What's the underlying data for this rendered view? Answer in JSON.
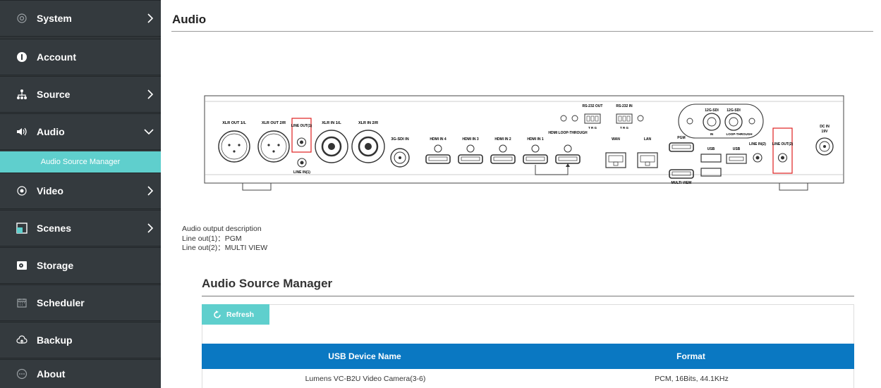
{
  "sidebar": {
    "items": [
      {
        "label": "System",
        "icon": "gear-icon",
        "chevron": "right"
      },
      {
        "label": "Account",
        "icon": "user-icon",
        "chevron": ""
      },
      {
        "label": "Source",
        "icon": "network-icon",
        "chevron": "right"
      },
      {
        "label": "Audio",
        "icon": "speaker-icon",
        "chevron": "down"
      },
      {
        "label": "Video",
        "icon": "record-icon",
        "chevron": "right"
      },
      {
        "label": "Scenes",
        "icon": "scenes-icon",
        "chevron": "right"
      },
      {
        "label": "Storage",
        "icon": "storage-icon",
        "chevron": ""
      },
      {
        "label": "Scheduler",
        "icon": "calendar-icon",
        "chevron": ""
      },
      {
        "label": "Backup",
        "icon": "cloud-upload-icon",
        "chevron": ""
      },
      {
        "label": "About",
        "icon": "info-icon",
        "chevron": ""
      }
    ],
    "sub_item": "Audio Source Manager"
  },
  "page": {
    "title": "Audio"
  },
  "device_panel": {
    "labels": {
      "xlr_out_1": "XLR OUT 1/L",
      "xlr_out_2": "XLR OUT 2/R",
      "line_out_1": "LINE OUT(1)",
      "xlr_in_1": "XLR IN 1/L",
      "xlr_in_2": "XLR IN 2/R",
      "line_in_1": "LINE IN(1)",
      "sdi_in": "3G-SDI IN",
      "hdmi_in_4": "HDMI IN 4",
      "hdmi_in_3": "HDMI IN 3",
      "hdmi_in_2": "HDMI IN 2",
      "hdmi_in_1": "HDMI IN 1",
      "hdmi_loop": "HDMI LOOP-THROUGH",
      "rs232_out": "RS-232 OUT",
      "rs232_in": "RS-232 IN",
      "trg": "T R G",
      "wan": "WAN",
      "lan": "LAN",
      "pgm": "PGM",
      "multi_view": "MULTI VIEW",
      "usb": "USB",
      "sdi12_a": "12G-SDI",
      "sdi12_b": "12G-SDI",
      "sdi12_in": "IN",
      "sdi12_loop": "LOOP-THROUGH",
      "line_in_2": "LINE IN(2)",
      "line_out_2": "LINE OUT(2)",
      "dc_in": "DC IN",
      "dc_volt": "19V"
    }
  },
  "description": {
    "heading": "Audio output description",
    "line1": "Line out(1)：PGM",
    "line2": "Line out(2)：MULTI VIEW"
  },
  "manager": {
    "title": "Audio Source Manager",
    "refresh_label": "Refresh",
    "columns": [
      "USB Device Name",
      "Format"
    ],
    "rows": [
      [
        "Lumens VC-B2U Video Camera(3-6)",
        "PCM, 16Bits, 44.1KHz"
      ]
    ]
  },
  "colors": {
    "sidebar_bg": "#343a3e",
    "accent_teal": "#5fcfcd",
    "table_header": "#0a78c2",
    "highlight_red": "#e02020"
  }
}
